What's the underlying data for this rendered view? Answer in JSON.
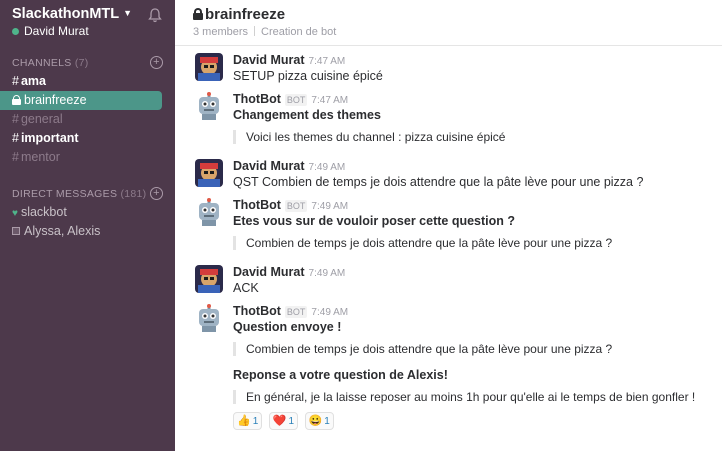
{
  "workspace": {
    "name": "SlackathonMTL",
    "user": "David Murat"
  },
  "sidebar": {
    "channels_label": "CHANNELS",
    "channels_count": "(7)",
    "channels": [
      {
        "name": "ama"
      },
      {
        "name": "brainfreeze"
      },
      {
        "name": "general"
      },
      {
        "name": "important"
      },
      {
        "name": "mentor"
      }
    ],
    "dm_label": "DIRECT MESSAGES",
    "dm_count": "(181)",
    "dms": [
      {
        "name": "slackbot"
      },
      {
        "name": "Alyssa, Alexis"
      }
    ]
  },
  "header": {
    "channel": "brainfreeze",
    "members": "3 members",
    "purpose": "Creation de bot"
  },
  "messages": [
    {
      "author": "David Murat",
      "time": "7:47 AM",
      "text": "SETUP pizza cuisine épicé"
    },
    {
      "author": "ThotBot",
      "badge": "BOT",
      "time": "7:47 AM",
      "text": "Changement des themes",
      "quote": "Voici les themes du channel : pizza cuisine épicé"
    },
    {
      "author": "David Murat",
      "time": "7:49 AM",
      "text": "QST Combien de temps je dois attendre que la pâte lève pour une pizza ?"
    },
    {
      "author": "ThotBot",
      "badge": "BOT",
      "time": "7:49 AM",
      "text": "Etes vous sur de vouloir poser cette question ?",
      "quote": "Combien de temps je dois attendre que la pâte lève pour une pizza ?"
    },
    {
      "author": "David Murat",
      "time": "7:49 AM",
      "text": "ACK"
    },
    {
      "author": "ThotBot",
      "badge": "BOT",
      "time": "7:49 AM",
      "text": "Question envoye !",
      "quote": "Combien de temps je dois attendre que la pâte lève pour une pizza ?",
      "text2": "Reponse a votre question de Alexis!",
      "quote2": "En général, je la laisse reposer au moins 1h pour qu'elle ai le temps de bien gonfler !",
      "reactions": [
        {
          "emoji": "👍",
          "count": "1"
        },
        {
          "emoji": "❤️",
          "count": "1"
        },
        {
          "emoji": "😀",
          "count": "1"
        }
      ]
    }
  ],
  "colors": {
    "sidebar": "#4d394b",
    "active": "#4c9689",
    "presence": "#4fb48b"
  }
}
